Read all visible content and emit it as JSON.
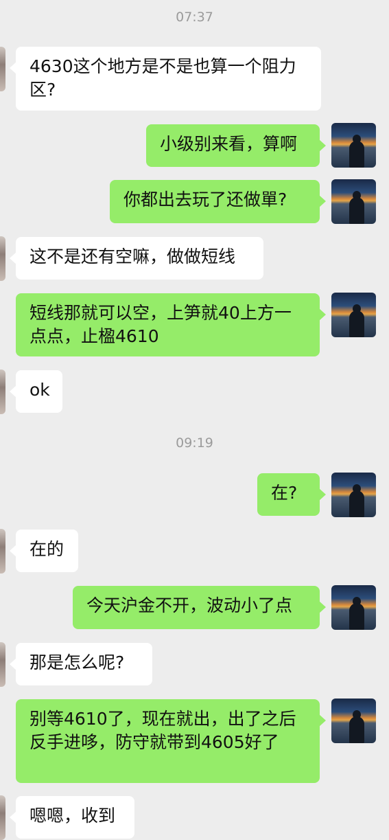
{
  "timestamps": [
    "07:37",
    "09:19"
  ],
  "messages": [
    {
      "side": "in",
      "text": "4630这个地方是不是也算一个阻力区?"
    },
    {
      "side": "out",
      "text": "小级别来看，算啊"
    },
    {
      "side": "out",
      "text": "你都出去玩了还做單?"
    },
    {
      "side": "in",
      "text": "这不是还有空嘛，做做短线"
    },
    {
      "side": "out",
      "text": "短线那就可以空，上笋就40上方一点点，止楹4610"
    },
    {
      "side": "in",
      "text": "ok"
    },
    {
      "side": "out",
      "text": "在?"
    },
    {
      "side": "in",
      "text": "在的"
    },
    {
      "side": "out",
      "text": "今天沪金不开，波动小了点"
    },
    {
      "side": "in",
      "text": "那是怎么呢?"
    },
    {
      "side": "out",
      "text": "别等4610了，现在就出，出了之后反手进哆，防守就带到4605好了"
    },
    {
      "side": "in",
      "text": "嗯嗯，收到"
    }
  ],
  "colors": {
    "background": "#ededed",
    "incoming": "#ffffff",
    "outgoing": "#95ec69"
  }
}
